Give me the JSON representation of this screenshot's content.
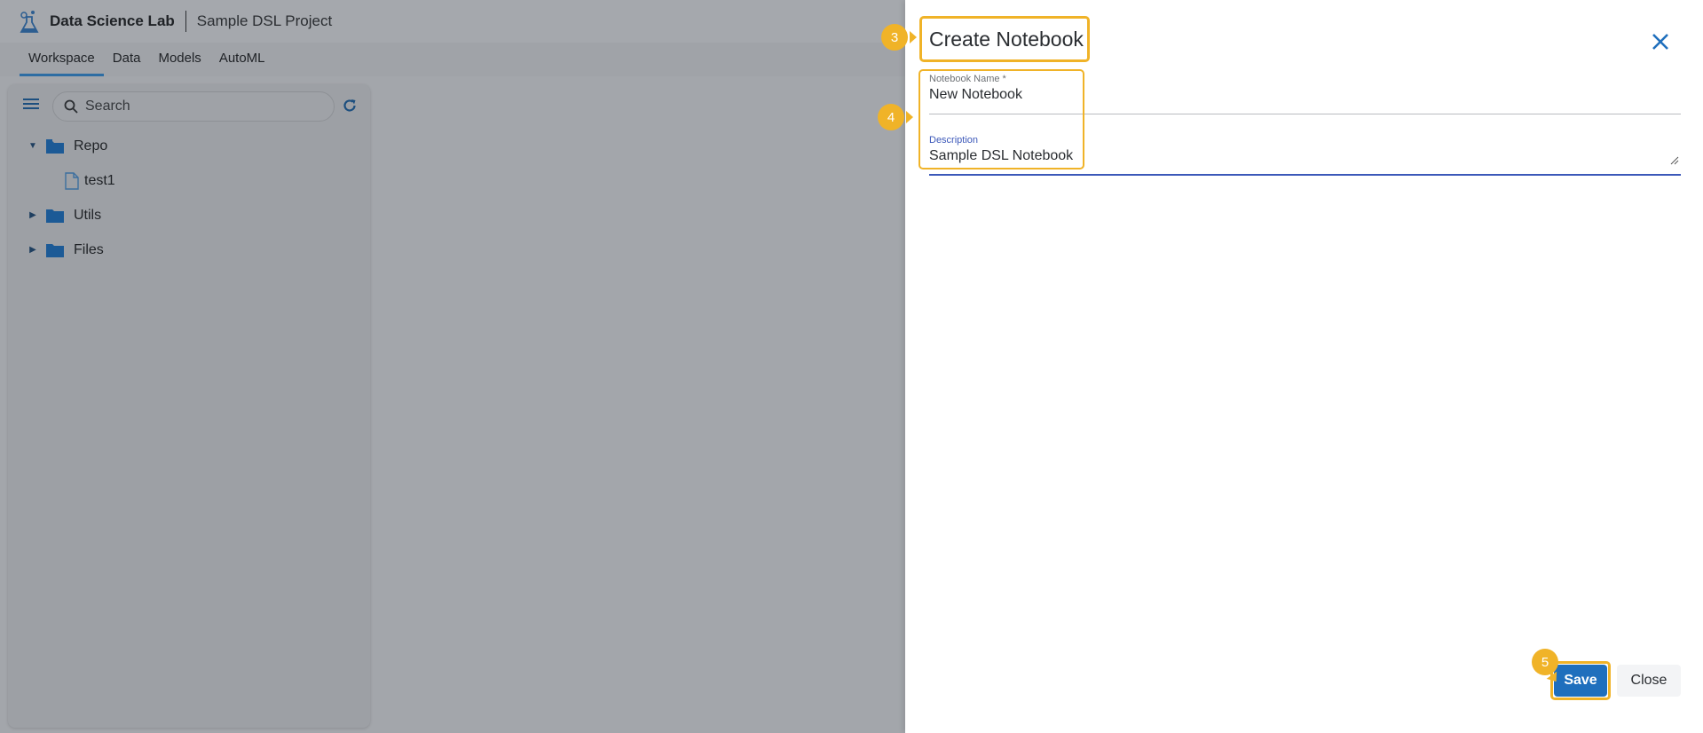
{
  "app": {
    "name": "Data Science Lab",
    "project": "Sample DSL Project"
  },
  "tabs": [
    {
      "label": "Workspace",
      "active": true
    },
    {
      "label": "Data",
      "active": false
    },
    {
      "label": "Models",
      "active": false
    },
    {
      "label": "AutoML",
      "active": false
    }
  ],
  "sidebar": {
    "search_placeholder": "Search",
    "tree": {
      "repo": "Repo",
      "repo_file": "test1",
      "utils": "Utils",
      "files": "Files"
    }
  },
  "modal": {
    "title": "Create Notebook",
    "name_label": "Notebook Name *",
    "name_value": "New Notebook",
    "description_label": "Description",
    "description_value": "Sample DSL Notebook",
    "save_label": "Save",
    "close_label": "Close"
  },
  "callouts": {
    "title_step": "3",
    "fields_step": "4",
    "save_step": "5"
  },
  "colors": {
    "accent": "#f0b328",
    "primary": "#1f6fbd",
    "folder": "#1c5a96"
  }
}
